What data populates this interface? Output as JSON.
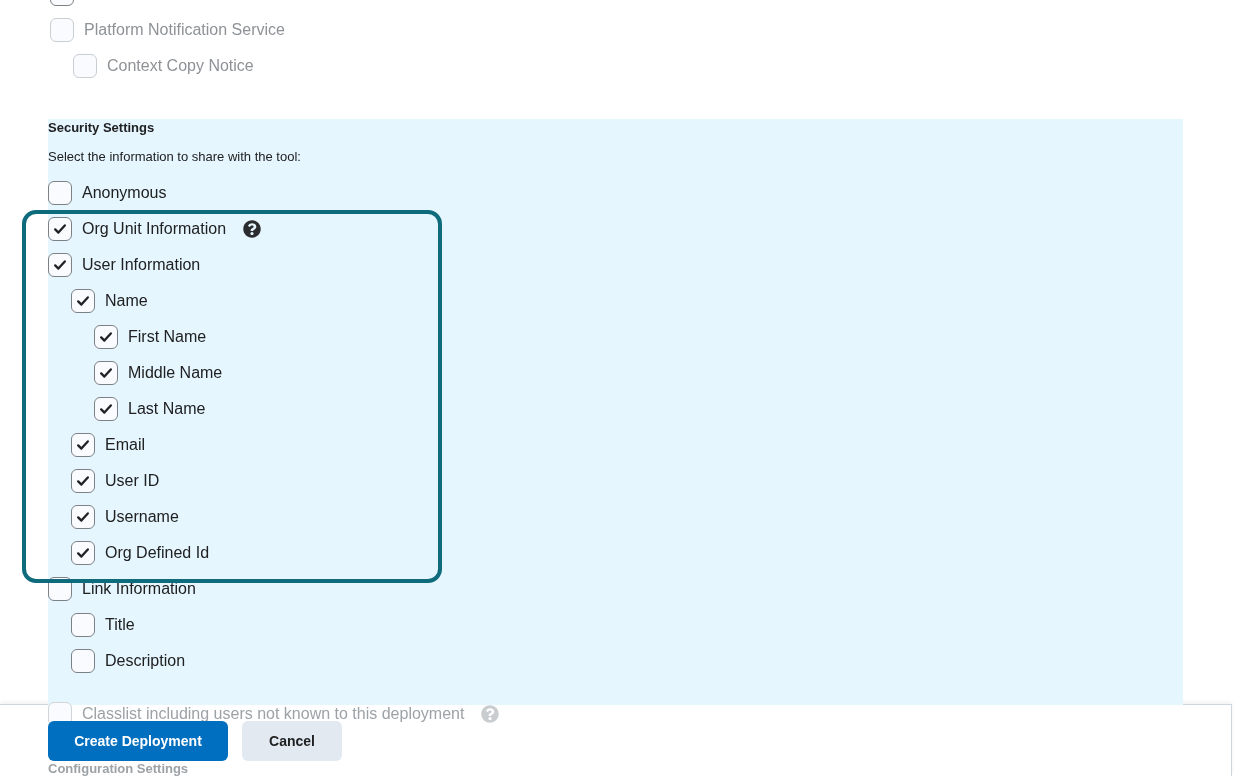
{
  "notification_options": [
    {
      "disabled": false
    },
    {
      "label": "Platform Notification Service",
      "checked": false,
      "disabled": true,
      "children": [
        {
          "label": "Context Copy Notice",
          "checked": false,
          "disabled": true
        }
      ]
    }
  ],
  "security": {
    "title": "Security Settings",
    "instruction": "Select the information to share with the tool:",
    "options": [
      {
        "label": "Anonymous",
        "checked": false
      },
      {
        "label": "Org Unit Information",
        "checked": true,
        "help": true,
        "highlighted": true
      },
      {
        "label": "User Information",
        "checked": true,
        "highlighted": true,
        "children": [
          {
            "label": "Name",
            "checked": true,
            "children": [
              {
                "label": "First Name",
                "checked": true
              },
              {
                "label": "Middle Name",
                "checked": true
              },
              {
                "label": "Last Name",
                "checked": true
              }
            ]
          },
          {
            "label": "Email",
            "checked": true
          },
          {
            "label": "User ID",
            "checked": true
          },
          {
            "label": "Username",
            "checked": true
          },
          {
            "label": "Org Defined Id",
            "checked": true
          }
        ]
      },
      {
        "label": "Link Information",
        "checked": false,
        "children": [
          {
            "label": "Title",
            "checked": false
          },
          {
            "label": "Description",
            "checked": false
          }
        ]
      }
    ],
    "extra_options": [
      {
        "label": "Classlist including users not known to this deployment",
        "checked": false,
        "help": true
      }
    ]
  },
  "next_section": {
    "title": "Configuration Settings"
  },
  "footer": {
    "buttons": [
      {
        "label": "Create Deployment",
        "kind": "primary"
      },
      {
        "label": "Cancel",
        "kind": "secondary"
      }
    ]
  }
}
